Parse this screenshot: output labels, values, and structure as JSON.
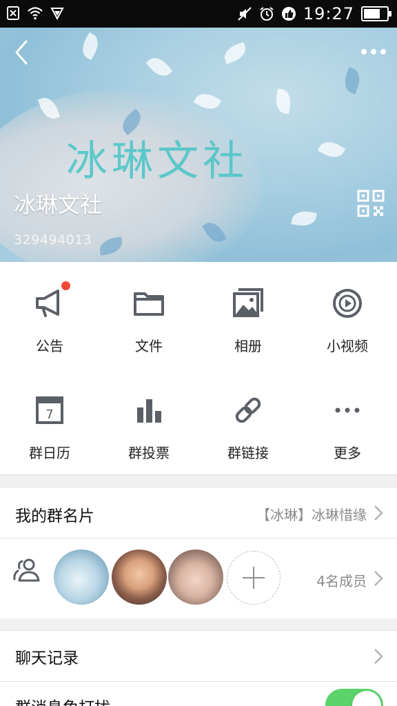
{
  "status_bar": {
    "time": "19:27",
    "battery_level": 0.72,
    "icons": [
      "sim-error-icon",
      "wifi-icon",
      "vpn-shield-icon",
      "mute-icon",
      "alarm-icon",
      "thumbs-up-icon"
    ]
  },
  "header": {
    "group_name": "冰琳文社",
    "group_id": "329494013",
    "banner_art_text": "冰琳文社"
  },
  "features": [
    {
      "label": "公告",
      "icon": "megaphone-icon",
      "badge": true
    },
    {
      "label": "文件",
      "icon": "folder-icon",
      "badge": false
    },
    {
      "label": "相册",
      "icon": "album-icon",
      "badge": false
    },
    {
      "label": "小视频",
      "icon": "video-play-icon",
      "badge": false
    },
    {
      "label": "群日历",
      "icon": "calendar-icon",
      "badge": false
    },
    {
      "label": "群投票",
      "icon": "bar-chart-icon",
      "badge": false
    },
    {
      "label": "群链接",
      "icon": "link-icon",
      "badge": false
    },
    {
      "label": "更多",
      "icon": "more-dots-icon",
      "badge": false
    }
  ],
  "calendar_day": "7",
  "group_card": {
    "title": "我的群名片",
    "value": "【冰琳】冰琳惜缘"
  },
  "members": {
    "count_text": "4名成员"
  },
  "chat_history": {
    "title": "聊天记录"
  },
  "message_dnd": {
    "title": "群消息免打扰",
    "enabled": true
  },
  "colors": {
    "accent_red": "#f04a37",
    "toggle_green": "#5bd36a",
    "banner_blue": "#a7cee1",
    "art_teal": "#4fc6c7",
    "icon_gray": "#5b5f66"
  }
}
